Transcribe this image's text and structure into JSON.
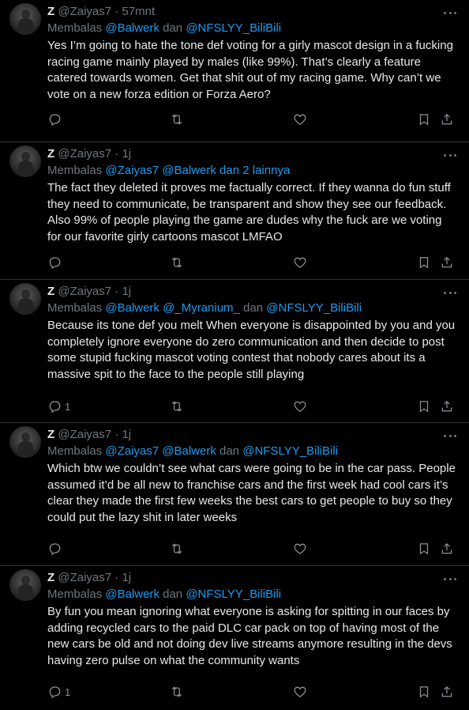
{
  "tweets": [
    {
      "name": "Z",
      "handle": "@Zaiyas7",
      "dot": "·",
      "time": "57mnt",
      "reply_prefix": "Membalas",
      "reply_mentions": [
        "@Balwerk",
        "@NFSLYY_BiliBili"
      ],
      "reply_joiners": [
        " ",
        " dan "
      ],
      "reply_suffix": "",
      "text": "Yes I’m going to hate the tone def voting for a girly mascot design in a fucking racing game mainly played by males (like 99%). That’s clearly a feature catered towards women. Get that shit out of my racing game. Why can’t we vote on a new forza edition or Forza Aero?",
      "reply_count": ""
    },
    {
      "name": "Z",
      "handle": "@Zaiyas7",
      "dot": "·",
      "time": "1j",
      "reply_prefix": "Membalas",
      "reply_mentions": [
        "@Zaiyas7",
        "@Balwerk"
      ],
      "reply_joiners": [
        " ",
        " "
      ],
      "reply_suffix": " dan 2 lainnya",
      "text": "The fact they deleted it proves me factually correct. If they wanna do fun stuff they need to communicate, be transparent and show they see our feedback. Also 99% of people playing the game are dudes why the fuck are we voting for our favorite girly cartoons mascot LMFAO",
      "reply_count": ""
    },
    {
      "name": "Z",
      "handle": "@Zaiyas7",
      "dot": "·",
      "time": "1j",
      "reply_prefix": "Membalas",
      "reply_mentions": [
        "@Balwerk",
        "@_Myranium_",
        "@NFSLYY_BiliBili"
      ],
      "reply_joiners": [
        " ",
        " ",
        " dan "
      ],
      "reply_suffix": "",
      "text": "Because its tone def you melt When everyone is disappointed by you and you completely ignore everyone do zero communication and then decide to post some stupid fucking mascot voting contest that nobody cares about its a massive spit to the face to the people still playing",
      "reply_count": "1"
    },
    {
      "name": "Z",
      "handle": "@Zaiyas7",
      "dot": "·",
      "time": "1j",
      "reply_prefix": "Membalas",
      "reply_mentions": [
        "@Zaiyas7",
        "@Balwerk",
        "@NFSLYY_BiliBili"
      ],
      "reply_joiners": [
        " ",
        " ",
        " dan "
      ],
      "reply_suffix": "",
      "text": "Which btw we couldn’t see what cars were going to be in the car pass. People assumed it’d be all new to franchise cars and the first week had cool cars it’s clear they made the first few weeks the best cars to get people to buy so they could put the lazy shit in later weeks",
      "reply_count": ""
    },
    {
      "name": "Z",
      "handle": "@Zaiyas7",
      "dot": "·",
      "time": "1j",
      "reply_prefix": "Membalas",
      "reply_mentions": [
        "@Balwerk",
        "@NFSLYY_BiliBili"
      ],
      "reply_joiners": [
        " ",
        " dan "
      ],
      "reply_suffix": "",
      "text": "By fun you mean ignoring what everyone is asking for spitting in our faces by adding recycled cars to the paid DLC car pack on top of having most of the new cars be old and not doing dev live streams anymore resulting in the devs having zero pulse on what the community wants",
      "reply_count": "1"
    }
  ],
  "icons": {
    "avatar": "avatar-image",
    "more": "more-icon",
    "reply": "reply-icon",
    "retweet": "retweet-icon",
    "like": "like-icon",
    "bookmark": "bookmark-icon",
    "share": "share-icon"
  },
  "colors": {
    "background": "#000000",
    "text": "#e7e9ea",
    "muted": "#71767b",
    "link": "#1d9bf0",
    "divider": "#2f3336"
  }
}
